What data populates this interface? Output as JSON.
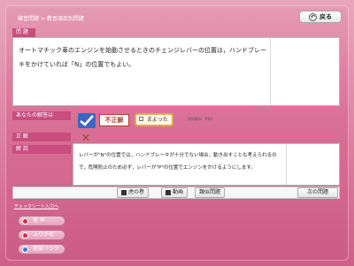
{
  "header": {
    "breadcrumb": "練習問題 > 教習項目別問題",
    "back_label": "戻る"
  },
  "question": {
    "tab_label": "問 題",
    "text": "オートマチック車のエンジンを始動させるときのチェンジレバーの位置は，ハンドブレーキをかけていれば「N」の位置でもよい。"
  },
  "answer": {
    "your_answer_label": "あなたの解答は",
    "verdict": "不正解",
    "maruta_label": "まよった",
    "learn_label": "学科教本　P.82"
  },
  "sections": {
    "correct_label": "正 解",
    "correct_mark": "✕",
    "explanation_label": "解 説",
    "explanation_text": "レバーが\"N\"の位置では，ハンドブレーキが十分でない場合，動き出すことも考えられるので，危険防止のため必ず，レバーが\"P\"の位置でエンジンをかけるようにします。"
  },
  "toolbar": {
    "tora_label": "虎の巻",
    "video_label": "動画",
    "similar_label": "類似問題",
    "next_label": "次の問題"
  },
  "footer": {
    "link_text": "チェックシート入力へ",
    "btn1": "音 声",
    "btn2": "ふりがな",
    "btn3": "用語リンク"
  }
}
